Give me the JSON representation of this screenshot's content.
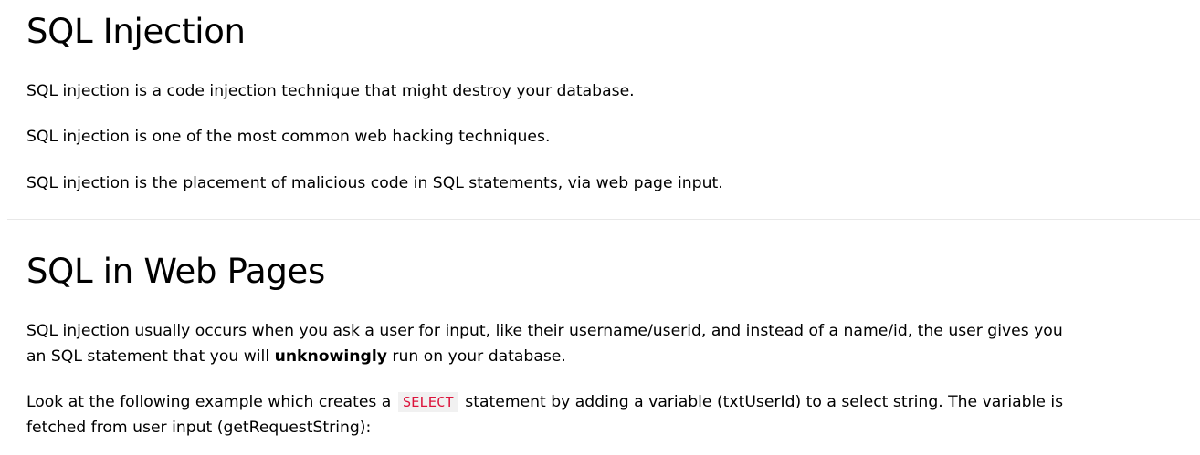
{
  "section1": {
    "heading": "SQL Injection",
    "paragraphs": [
      "SQL injection is a code injection technique that might destroy your database.",
      "SQL injection is one of the most common web hacking techniques.",
      "SQL injection is the placement of malicious code in SQL statements, via web page input."
    ]
  },
  "section2": {
    "heading": "SQL in Web Pages",
    "p1": {
      "line1": "SQL injection usually occurs when you ask a user for input, like their username/userid, and instead of a name/id, the user gives you",
      "line2_before": "an SQL statement that you will ",
      "line2_bold": "unknowingly",
      "line2_after": " run on your database."
    },
    "p2": {
      "line1_before": "Look at the following example which creates a ",
      "code": "SELECT",
      "line1_after": " statement by adding a variable (txtUserId) to a select string. The variable is",
      "line2": "fetched from user input (getRequestString):"
    }
  },
  "colors": {
    "code_text": "#dc143c",
    "code_background": "#f1f1f1",
    "divider": "#e8e8e8"
  }
}
